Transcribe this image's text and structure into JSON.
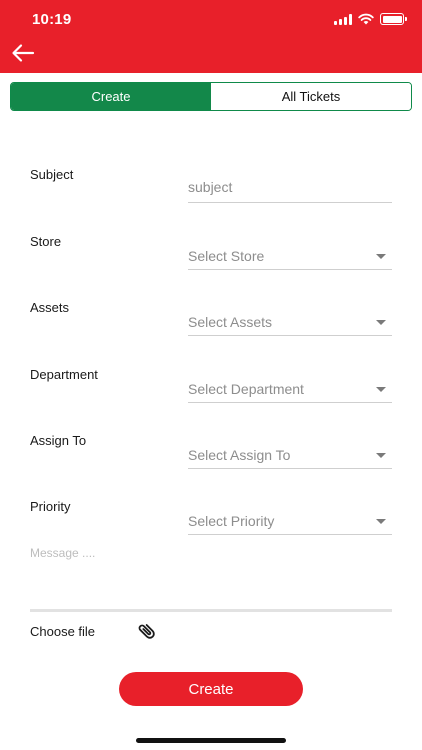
{
  "status_bar": {
    "time": "10:19"
  },
  "tabs": [
    {
      "label": "Create",
      "active": true
    },
    {
      "label": "All Tickets",
      "active": false
    }
  ],
  "form": {
    "subject": {
      "label": "Subject",
      "placeholder": "subject"
    },
    "store": {
      "label": "Store",
      "value": "Select Store"
    },
    "assets": {
      "label": "Assets",
      "value": "Select Assets"
    },
    "department": {
      "label": "Department",
      "value": "Select Department"
    },
    "assign_to": {
      "label": "Assign To",
      "value": "Select Assign To"
    },
    "priority": {
      "label": "Priority",
      "value": "Select Priority"
    },
    "message": {
      "placeholder": "Message ...."
    },
    "choose_file": {
      "label": "Choose file"
    }
  },
  "create_button": {
    "label": "Create"
  },
  "colors": {
    "brand_red": "#e8202a",
    "tab_green": "#13884a"
  },
  "icons": {
    "back": "arrow-left-icon",
    "attach": "paperclip-icon",
    "dropdown": "caret-down-icon"
  }
}
